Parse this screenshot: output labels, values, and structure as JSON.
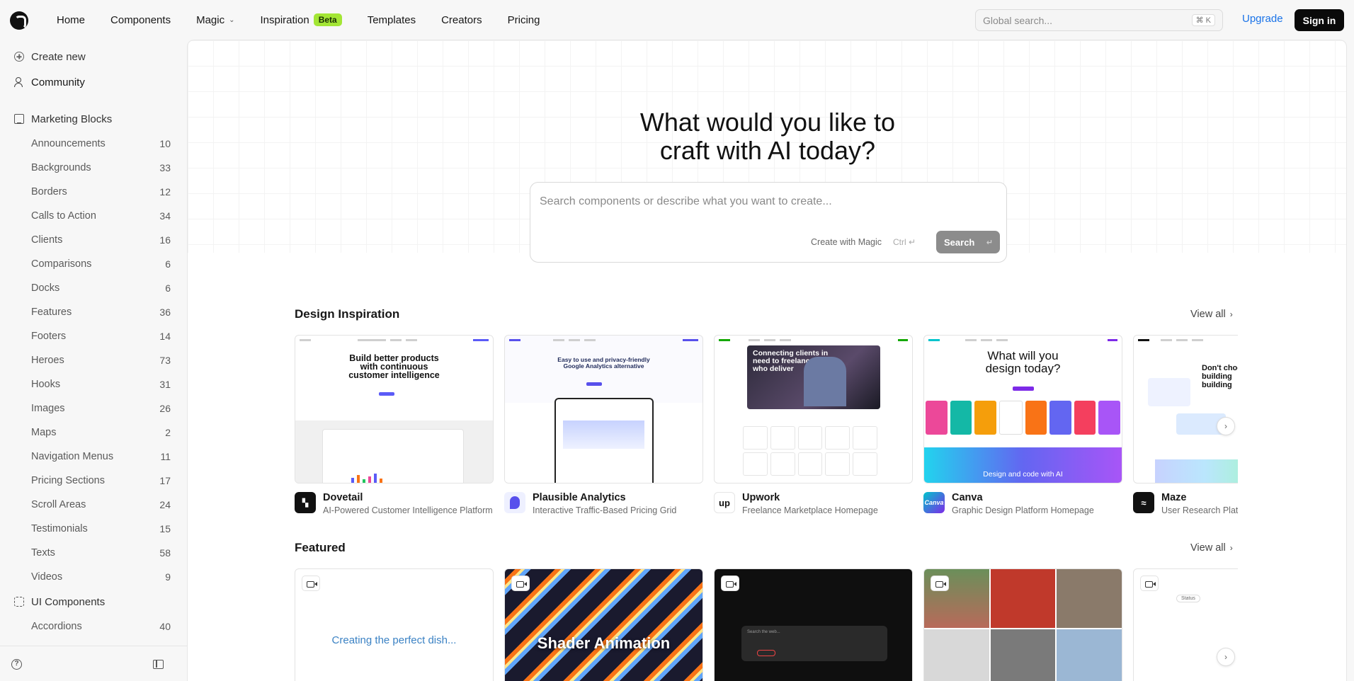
{
  "nav": {
    "items": [
      "Home",
      "Components",
      "Magic",
      "Inspiration",
      "Templates",
      "Creators",
      "Pricing"
    ],
    "beta_badge": "Beta",
    "search_placeholder": "Global search...",
    "search_kbd": "⌘ K",
    "upgrade": "Upgrade",
    "signin": "Sign in"
  },
  "sidebar": {
    "top": [
      {
        "label": "Create new",
        "icon": "plus-circle-icon"
      },
      {
        "label": "Community",
        "icon": "users-icon"
      }
    ],
    "group1": {
      "label": "Marketing Blocks",
      "icon": "monitor-icon"
    },
    "items": [
      {
        "label": "Announcements",
        "count": "10"
      },
      {
        "label": "Backgrounds",
        "count": "33"
      },
      {
        "label": "Borders",
        "count": "12"
      },
      {
        "label": "Calls to Action",
        "count": "34"
      },
      {
        "label": "Clients",
        "count": "16"
      },
      {
        "label": "Comparisons",
        "count": "6"
      },
      {
        "label": "Docks",
        "count": "6"
      },
      {
        "label": "Features",
        "count": "36"
      },
      {
        "label": "Footers",
        "count": "14"
      },
      {
        "label": "Heroes",
        "count": "73"
      },
      {
        "label": "Hooks",
        "count": "31"
      },
      {
        "label": "Images",
        "count": "26"
      },
      {
        "label": "Maps",
        "count": "2"
      },
      {
        "label": "Navigation Menus",
        "count": "11"
      },
      {
        "label": "Pricing Sections",
        "count": "17"
      },
      {
        "label": "Scroll Areas",
        "count": "24"
      },
      {
        "label": "Testimonials",
        "count": "15"
      },
      {
        "label": "Texts",
        "count": "58"
      },
      {
        "label": "Videos",
        "count": "9"
      }
    ],
    "group2": {
      "label": "UI Components",
      "icon": "ui-components-icon"
    },
    "items2": [
      {
        "label": "Accordions",
        "count": "40"
      }
    ]
  },
  "hero": {
    "title_line1": "What would you like to",
    "title_line2": "craft with AI today?",
    "placeholder": "Search components or describe what you want to create...",
    "create_with_magic": "Create with Magic",
    "ctrl_hint": "Ctrl ↵",
    "search_button": "Search",
    "search_kbd": "↵"
  },
  "design_inspiration": {
    "title": "Design Inspiration",
    "view_all": "View all",
    "cards": [
      {
        "name": "Dovetail",
        "desc": "AI-Powered Customer Intelligence Platform",
        "headline": "Build better products with continuous customer intelligence",
        "logo_color": "#111111"
      },
      {
        "name": "Plausible Analytics",
        "desc": "Interactive Traffic-Based Pricing Grid",
        "headline": "Easy to use and privacy-friendly Google Analytics alternative",
        "logo_color": "#5850ec"
      },
      {
        "name": "Upwork",
        "desc": "Freelance Marketplace Homepage",
        "headline": "Connecting clients in need to freelancers who deliver",
        "logo_color": "#ffffff"
      },
      {
        "name": "Canva",
        "desc": "Graphic Design Platform Homepage",
        "headline": "What will you design today?",
        "footer": "Design and code with AI",
        "logo_color": "#00c4cc"
      },
      {
        "name": "Maze",
        "desc": "User Research Platform",
        "headline": "Don't choose building building",
        "logo_color": "#111111"
      }
    ]
  },
  "featured": {
    "title": "Featured",
    "view_all": "View all",
    "cards": [
      {
        "caption": "Creating the perfect dish..."
      },
      {
        "caption": "Shader Animation"
      },
      {
        "caption": "Search the web..."
      },
      {
        "caption": ""
      },
      {
        "caption": "Status"
      }
    ]
  }
}
